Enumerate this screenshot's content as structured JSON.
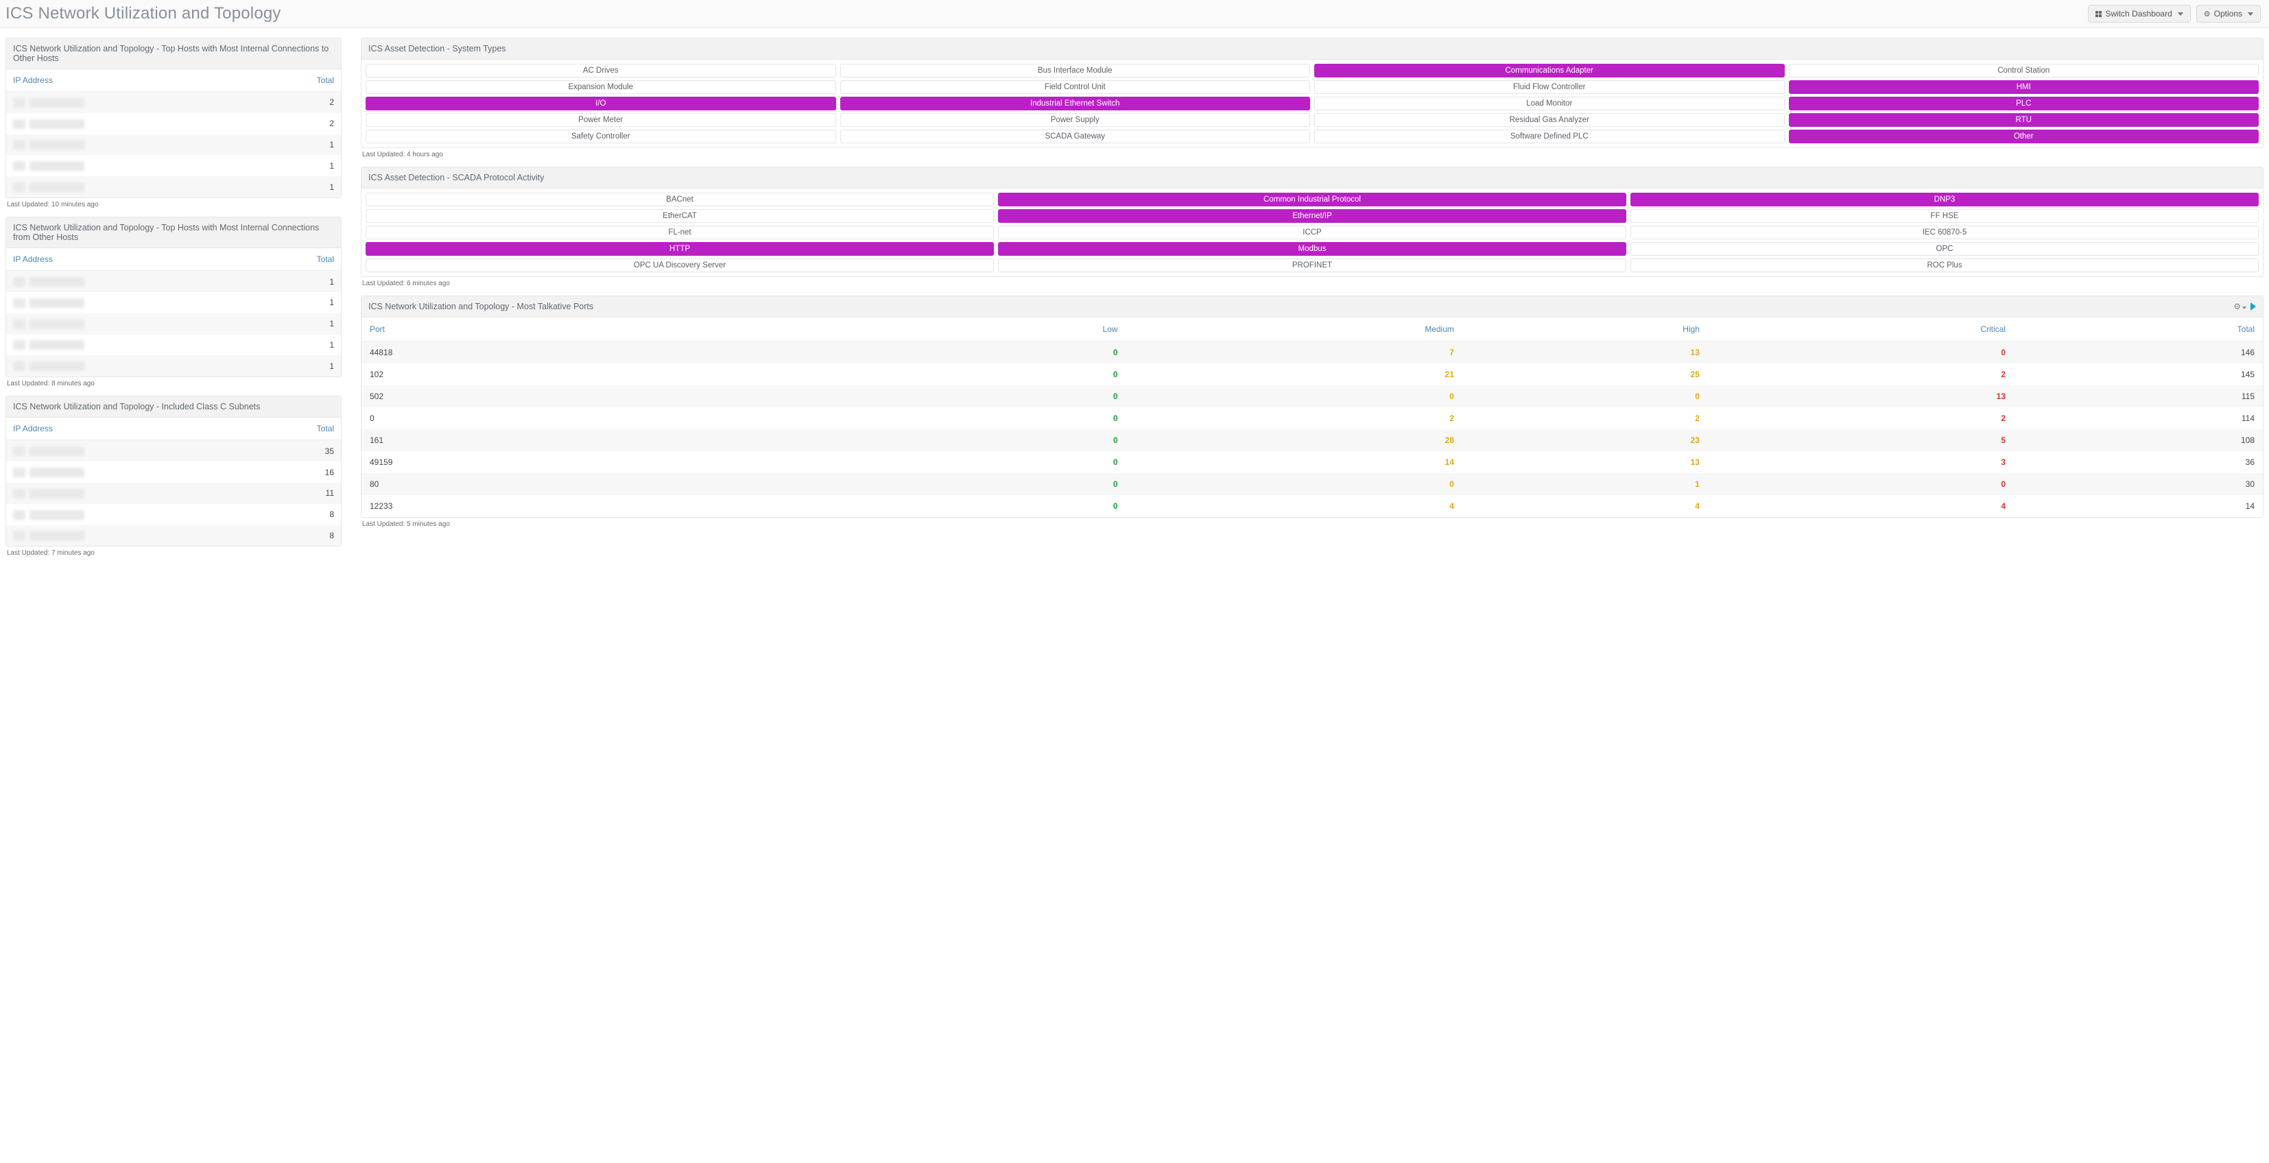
{
  "header": {
    "title": "ICS Network Utilization and Topology",
    "switch_dashboard_label": "Switch Dashboard",
    "options_label": "Options"
  },
  "left": {
    "panel_to": {
      "title": "ICS Network Utilization and Topology - Top Hosts with Most Internal Connections to Other Hosts",
      "cols": {
        "ip": "IP Address",
        "total": "Total"
      },
      "rows": [
        {
          "ip": "",
          "total": 2
        },
        {
          "ip": "",
          "total": 2
        },
        {
          "ip": "",
          "total": 1
        },
        {
          "ip": "",
          "total": 1
        },
        {
          "ip": "",
          "total": 1
        }
      ],
      "updated": "Last Updated: 10 minutes ago"
    },
    "panel_from": {
      "title": "ICS Network Utilization and Topology - Top Hosts with Most Internal Connections from Other Hosts",
      "cols": {
        "ip": "IP Address",
        "total": "Total"
      },
      "rows": [
        {
          "ip": "",
          "total": 1
        },
        {
          "ip": "",
          "total": 1
        },
        {
          "ip": "",
          "total": 1
        },
        {
          "ip": "",
          "total": 1
        },
        {
          "ip": "",
          "total": 1
        }
      ],
      "updated": "Last Updated: 8 minutes ago"
    },
    "panel_subnets": {
      "title": "ICS Network Utilization and Topology - Included Class C Subnets",
      "cols": {
        "ip": "IP Address",
        "total": "Total"
      },
      "rows": [
        {
          "ip": "",
          "total": 35
        },
        {
          "ip": "",
          "total": 16
        },
        {
          "ip": "",
          "total": 11
        },
        {
          "ip": "",
          "total": 8
        },
        {
          "ip": "",
          "total": 8
        }
      ],
      "updated": "Last Updated: 7 minutes ago"
    }
  },
  "right": {
    "system_types": {
      "title": "ICS Asset Detection - System Types",
      "items": [
        {
          "label": "AC Drives",
          "active": false
        },
        {
          "label": "Bus Interface Module",
          "active": false
        },
        {
          "label": "Communications Adapter",
          "active": true
        },
        {
          "label": "Control Station",
          "active": false
        },
        {
          "label": "Expansion Module",
          "active": false
        },
        {
          "label": "Field Control Unit",
          "active": false
        },
        {
          "label": "Fluid Flow Controller",
          "active": false
        },
        {
          "label": "HMI",
          "active": true
        },
        {
          "label": "I/O",
          "active": true
        },
        {
          "label": "Industrial Ethernet Switch",
          "active": true
        },
        {
          "label": "Load Monitor",
          "active": false
        },
        {
          "label": "PLC",
          "active": true
        },
        {
          "label": "Power Meter",
          "active": false
        },
        {
          "label": "Power Supply",
          "active": false
        },
        {
          "label": "Residual Gas Analyzer",
          "active": false
        },
        {
          "label": "RTU",
          "active": true
        },
        {
          "label": "Safety Controller",
          "active": false
        },
        {
          "label": "SCADA Gateway",
          "active": false
        },
        {
          "label": "Software Defined PLC",
          "active": false
        },
        {
          "label": "Other",
          "active": true
        }
      ],
      "updated": "Last Updated: 4 hours ago"
    },
    "scada": {
      "title": "ICS Asset Detection - SCADA Protocol Activity",
      "items": [
        {
          "label": "BACnet",
          "active": false
        },
        {
          "label": "Common Industrial Protocol",
          "active": true
        },
        {
          "label": "DNP3",
          "active": true
        },
        {
          "label": "EtherCAT",
          "active": false
        },
        {
          "label": "Ethernet/IP",
          "active": true
        },
        {
          "label": "FF HSE",
          "active": false
        },
        {
          "label": "FL-net",
          "active": false
        },
        {
          "label": "ICCP",
          "active": false
        },
        {
          "label": "IEC 60870-5",
          "active": false
        },
        {
          "label": "HTTP",
          "active": true
        },
        {
          "label": "Modbus",
          "active": true
        },
        {
          "label": "OPC",
          "active": false
        },
        {
          "label": "OPC UA Discovery Server",
          "active": false
        },
        {
          "label": "PROFINET",
          "active": false
        },
        {
          "label": "ROC Plus",
          "active": false
        }
      ],
      "updated": "Last Updated: 6 minutes ago"
    },
    "ports": {
      "title": "ICS Network Utilization and Topology - Most Talkative Ports",
      "cols": {
        "port": "Port",
        "low": "Low",
        "medium": "Medium",
        "high": "High",
        "critical": "Critical",
        "total": "Total"
      },
      "rows": [
        {
          "port": "44818",
          "low": 0,
          "medium": 7,
          "high": 13,
          "critical": 0,
          "total": 146
        },
        {
          "port": "102",
          "low": 0,
          "medium": 21,
          "high": 25,
          "critical": 2,
          "total": 145
        },
        {
          "port": "502",
          "low": 0,
          "medium": 0,
          "high": 0,
          "critical": 13,
          "total": 115
        },
        {
          "port": "0",
          "low": 0,
          "medium": 2,
          "high": 2,
          "critical": 2,
          "total": 114
        },
        {
          "port": "161",
          "low": 0,
          "medium": 28,
          "high": 23,
          "critical": 5,
          "total": 108
        },
        {
          "port": "49159",
          "low": 0,
          "medium": 14,
          "high": 13,
          "critical": 3,
          "total": 36
        },
        {
          "port": "80",
          "low": 0,
          "medium": 0,
          "high": 1,
          "critical": 0,
          "total": 30
        },
        {
          "port": "12233",
          "low": 0,
          "medium": 4,
          "high": 4,
          "critical": 4,
          "total": 14
        }
      ],
      "updated": "Last Updated: 5 minutes ago"
    }
  }
}
